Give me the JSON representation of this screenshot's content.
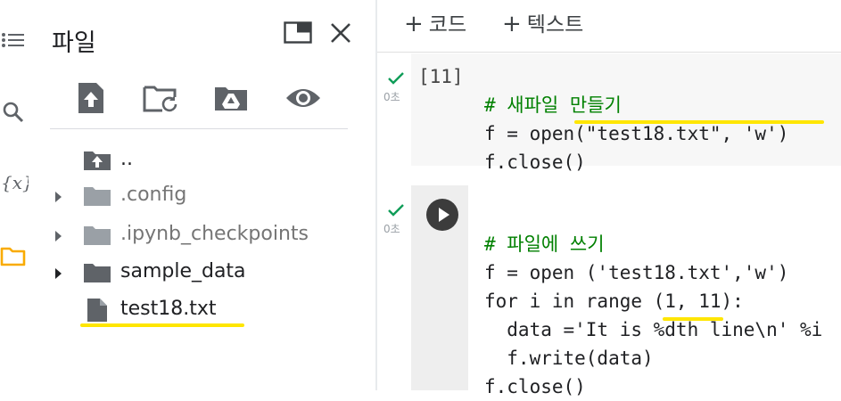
{
  "file_panel": {
    "title": "파일",
    "items": [
      {
        "name": "..",
        "type": "parent",
        "expandable": false
      },
      {
        "name": ".config",
        "type": "folder",
        "expandable": true
      },
      {
        "name": ".ipynb_checkpoints",
        "type": "folder",
        "expandable": true
      },
      {
        "name": "sample_data",
        "type": "folder",
        "expandable": true
      },
      {
        "name": "test18.txt",
        "type": "file",
        "expandable": false
      }
    ]
  },
  "notebook": {
    "toolbar": {
      "code_label": "코드",
      "text_label": "텍스트"
    },
    "cells": [
      {
        "exec_count": "[11]",
        "time": "0초",
        "lines": [
          "# 새파일 만들기",
          "f = open(\"test18.txt\", 'w')",
          "f.close()"
        ]
      },
      {
        "time": "0초",
        "lines": [
          "# 파일에 쓰기",
          "f = open ('test18.txt','w')",
          "for i in range (1, 11):",
          "  data ='It is %dth line\\n' %i",
          "  f.write(data)",
          "f.close()"
        ]
      }
    ]
  },
  "colors": {
    "accent_folder": "#f9ab00",
    "success_check": "#0f9d58",
    "highlight": "#ffe600"
  },
  "icons": {
    "rail": [
      "toc-icon",
      "search-icon",
      "variables-icon",
      "folder-icon"
    ],
    "toolbar": [
      "upload-icon",
      "refresh-folder-icon",
      "drive-icon",
      "eye-icon"
    ]
  }
}
